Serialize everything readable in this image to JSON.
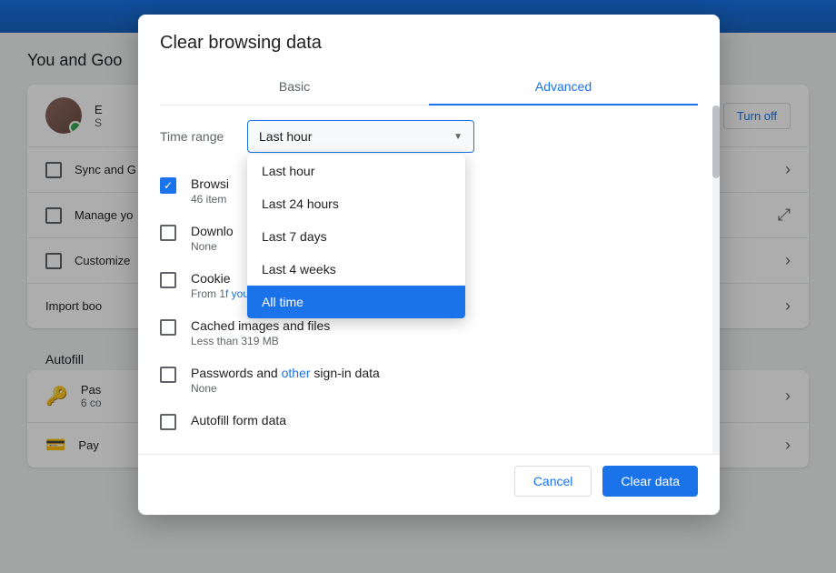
{
  "bg": {
    "section_you_goo": "You and Goo",
    "profile_name": "E",
    "profile_sub": "S",
    "sync_label": "Sync and G",
    "manage_label": "Manage yo",
    "customize_label": "Customize",
    "import_label": "Import boo",
    "autofill_label": "Autofill",
    "pass_label": "Pas",
    "pass_sub": "6 co",
    "pay_label": "Pay",
    "turn_off_label": "Turn off"
  },
  "dialog": {
    "title": "Clear browsing data",
    "tabs": [
      {
        "id": "basic",
        "label": "Basic",
        "active": false
      },
      {
        "id": "advanced",
        "label": "Advanced",
        "active": true
      }
    ],
    "time_range_label": "Time range",
    "select_value": "Last hour",
    "dropdown_options": [
      {
        "id": "last-hour",
        "label": "Last hour",
        "selected": false
      },
      {
        "id": "last-24-hours",
        "label": "Last 24 hours",
        "selected": false
      },
      {
        "id": "last-7-days",
        "label": "Last 7 days",
        "selected": false
      },
      {
        "id": "last-4-weeks",
        "label": "Last 4 weeks",
        "selected": false
      },
      {
        "id": "all-time",
        "label": "All time",
        "selected": true
      }
    ],
    "checklist": [
      {
        "id": "browsing-history",
        "label": "Browsi",
        "sub": "46 item",
        "checked": true
      },
      {
        "id": "download-history",
        "label": "Downlo",
        "sub": "None",
        "checked": false
      },
      {
        "id": "cookies",
        "label": "Cookie",
        "sub": "From 1",
        "sub_highlight": "f your Google Account)",
        "checked": false
      },
      {
        "id": "cached-images",
        "label": "Cached images and files",
        "sub": "Less than 319 MB",
        "checked": false
      },
      {
        "id": "passwords",
        "label": "Passwords and other sign-in data",
        "sub": "None",
        "sub_highlight": "other",
        "checked": false
      },
      {
        "id": "autofill",
        "label": "Autofill form data",
        "sub": "",
        "checked": false,
        "partial": true
      }
    ],
    "footer": {
      "cancel_label": "Cancel",
      "clear_label": "Clear data"
    }
  }
}
